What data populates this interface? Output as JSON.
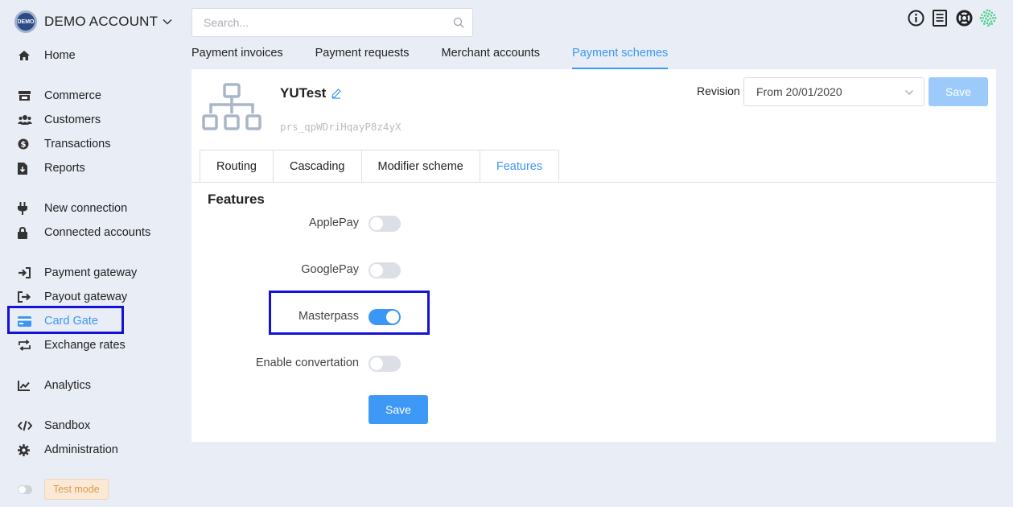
{
  "account": {
    "logo_text": "DEMO",
    "name": "DEMO ACCOUNT"
  },
  "sidebar": {
    "items": [
      {
        "label": "Home",
        "icon": "home-icon"
      },
      {
        "label": "Commerce",
        "icon": "store-icon"
      },
      {
        "label": "Customers",
        "icon": "users-icon"
      },
      {
        "label": "Transactions",
        "icon": "dollar-circle-icon"
      },
      {
        "label": "Reports",
        "icon": "file-download-icon"
      },
      {
        "label": "New connection",
        "icon": "plug-icon"
      },
      {
        "label": "Connected accounts",
        "icon": "lock-icon"
      },
      {
        "label": "Payment gateway",
        "icon": "sign-in-icon"
      },
      {
        "label": "Payout gateway",
        "icon": "sign-out-icon"
      },
      {
        "label": "Card Gate",
        "icon": "credit-card-icon",
        "active": true
      },
      {
        "label": "Exchange rates",
        "icon": "exchange-icon"
      },
      {
        "label": "Analytics",
        "icon": "chart-line-icon"
      },
      {
        "label": "Sandbox",
        "icon": "code-icon"
      },
      {
        "label": "Administration",
        "icon": "gear-icon"
      }
    ],
    "test_mode": "Test mode"
  },
  "search": {
    "placeholder": "Search..."
  },
  "top_tabs": [
    {
      "label": "Payment invoices"
    },
    {
      "label": "Payment requests"
    },
    {
      "label": "Merchant accounts"
    },
    {
      "label": "Payment schemes",
      "active": true
    }
  ],
  "scheme": {
    "name": "YUTest",
    "id": "prs_qpWDriHqayP8z4yX",
    "revision_label": "Revision",
    "revision_value": "From 20/01/2020",
    "save_label": "Save"
  },
  "inner_tabs": [
    {
      "label": "Routing"
    },
    {
      "label": "Cascading"
    },
    {
      "label": "Modifier scheme"
    },
    {
      "label": "Features",
      "active": true
    }
  ],
  "features": {
    "title": "Features",
    "items": [
      {
        "label": "ApplePay",
        "enabled": false
      },
      {
        "label": "GooglePay",
        "enabled": false
      },
      {
        "label": "Masterpass",
        "enabled": true
      },
      {
        "label": "Enable convertation",
        "enabled": false
      }
    ],
    "save_label": "Save"
  },
  "colors": {
    "accent": "#3b97f6",
    "highlight": "#1212d8",
    "save_disabled": "#9ccbfb"
  }
}
